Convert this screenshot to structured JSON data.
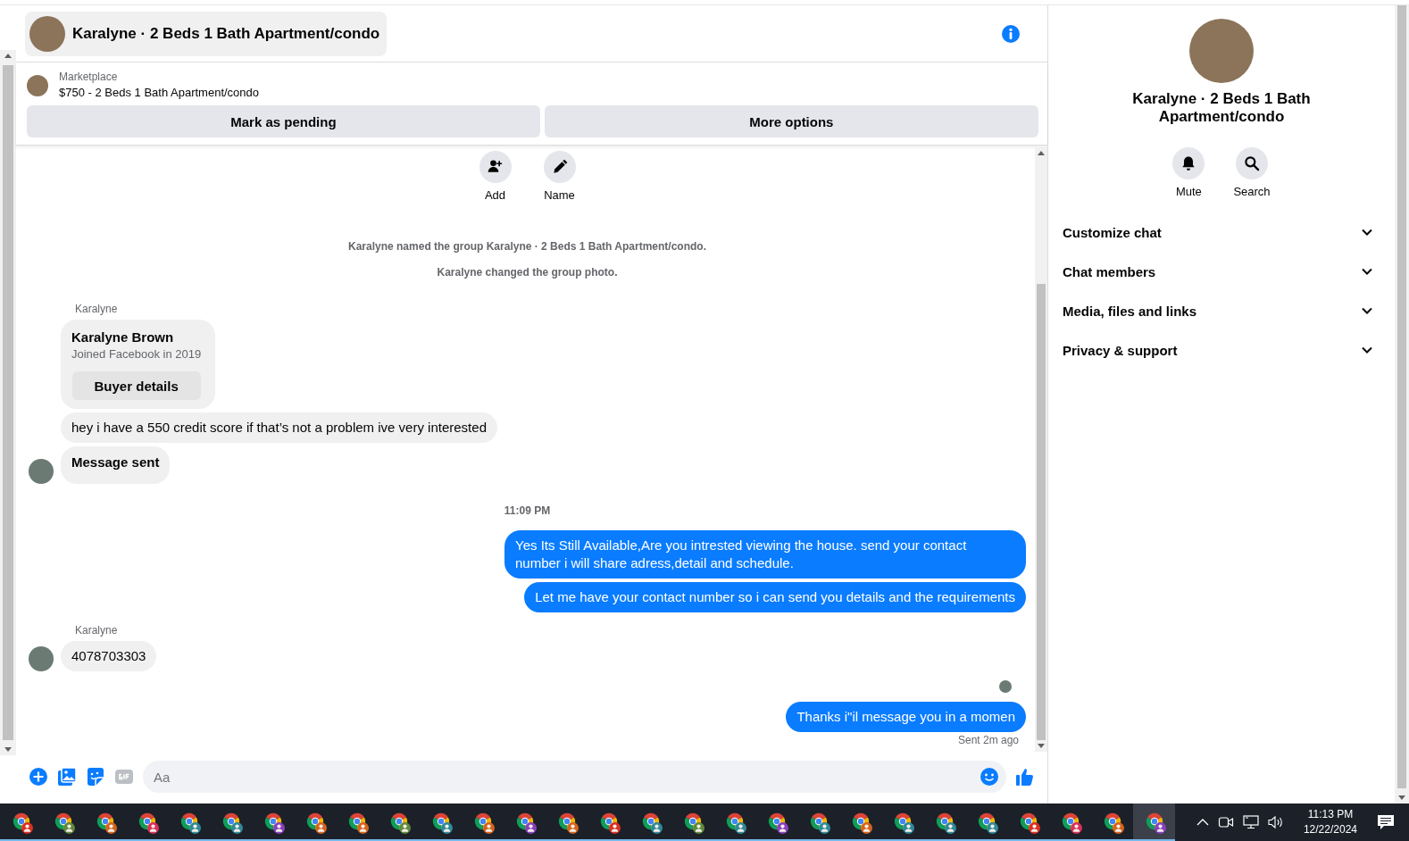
{
  "header": {
    "title": "Karalyne · 2 Beds 1 Bath Apartment/condo"
  },
  "listing": {
    "source": "Marketplace",
    "title": "$750 - 2 Beds 1 Bath Apartment/condo",
    "buttons": [
      "Mark as pending",
      "More options"
    ]
  },
  "thread_actions": [
    {
      "label": "Add",
      "kind": "add"
    },
    {
      "label": "Name",
      "kind": "name"
    }
  ],
  "messages": [
    {
      "kind": "note",
      "text": "Karalyne named the group Karalyne · 2 Beds 1 Bath Apartment/condo."
    },
    {
      "kind": "note",
      "text": "Karalyne changed the group photo."
    },
    {
      "kind": "sender",
      "text": "Karalyne"
    },
    {
      "kind": "card",
      "name": "Karalyne Brown",
      "subtitle": "Joined Facebook in 2019",
      "button": "Buyer details"
    },
    {
      "kind": "in",
      "text": "hey i have a 550 credit score if that’s not a problem ive very interested",
      "avatar": false,
      "bold": false
    },
    {
      "kind": "in",
      "text": "Message sent",
      "avatar": true,
      "bold": true
    },
    {
      "kind": "time",
      "text": "11:09 PM"
    },
    {
      "kind": "out",
      "text": "Yes Its Still Available,Are you intrested viewing the house. send your contact number i will share adress,detail and schedule."
    },
    {
      "kind": "out",
      "text": "Let me have your contact number so i can send you details and the requirements"
    },
    {
      "kind": "sender",
      "text": "Karalyne"
    },
    {
      "kind": "in",
      "text": "4078703303",
      "avatar": true,
      "bold": false
    },
    {
      "kind": "seen"
    },
    {
      "kind": "out",
      "text": "Thanks i\"il message you in a momen"
    },
    {
      "kind": "status",
      "text": "Sent 2m ago"
    }
  ],
  "composer": {
    "placeholder": "Aa"
  },
  "details": {
    "title": "Karalyne · 2 Beds 1 Bath Apartment/condo",
    "actions": [
      {
        "label": "Mute",
        "kind": "mute"
      },
      {
        "label": "Search",
        "kind": "search"
      }
    ],
    "sections": [
      {
        "label": "Customize chat",
        "expanded": false
      },
      {
        "label": "Chat members",
        "expanded": false
      },
      {
        "label": "Media, files and links",
        "expanded": false
      },
      {
        "label": "Privacy & support",
        "expanded": false
      }
    ]
  },
  "taskbar": {
    "apps": [
      {
        "color": "#d93025",
        "selected": false
      },
      {
        "color": "#5f8a3c",
        "selected": false
      },
      {
        "color": "#d4641c",
        "selected": false
      },
      {
        "color": "#d9305a",
        "selected": false
      },
      {
        "color": "#2f8a9a",
        "selected": false
      },
      {
        "color": "#2f8a9a",
        "selected": false
      },
      {
        "color": "#8a3fc0",
        "selected": false
      },
      {
        "color": "#d4641c",
        "selected": false
      },
      {
        "color": "#d4641c",
        "selected": false
      },
      {
        "color": "#5f8a3c",
        "selected": false
      },
      {
        "color": "#2f8a9a",
        "selected": false
      },
      {
        "color": "#d4641c",
        "selected": false
      },
      {
        "color": "#8a3fc0",
        "selected": false
      },
      {
        "color": "#d4641c",
        "selected": false
      },
      {
        "color": "#d93025",
        "selected": false
      },
      {
        "color": "#2f8a9a",
        "selected": false
      },
      {
        "color": "#5f8a3c",
        "selected": false
      },
      {
        "color": "#2f8a9a",
        "selected": false
      },
      {
        "color": "#8a3fc0",
        "selected": false
      },
      {
        "color": "#2f8a9a",
        "selected": false
      },
      {
        "color": "#d4641c",
        "selected": false
      },
      {
        "color": "#2f8a9a",
        "selected": false
      },
      {
        "color": "#2f8a9a",
        "selected": false
      },
      {
        "color": "#2f8a9a",
        "selected": false
      },
      {
        "color": "#d93025",
        "selected": false
      },
      {
        "color": "#d9305a",
        "selected": false
      },
      {
        "color": "#d4641c",
        "selected": false
      },
      {
        "color": "#8a3fc0",
        "selected": true
      }
    ],
    "time": "11:13 PM",
    "date": "12/22/2024"
  }
}
